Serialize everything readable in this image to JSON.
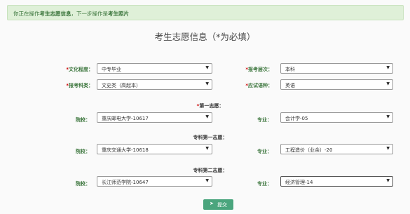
{
  "notice": {
    "prefix": "你正在操作",
    "current": "考生志愿信息",
    "middle": "，下一步操作是",
    "next": "考生照片"
  },
  "page_title": "考生志愿信息（*为必填）",
  "fields": {
    "education": {
      "label": "文化程度：",
      "value": "中专毕业"
    },
    "level": {
      "label": "报考层次：",
      "value": "本科"
    },
    "category": {
      "label": "报考科类：",
      "value": "文史类（高起本）"
    },
    "language": {
      "label": "应试语种：",
      "value": "英语"
    }
  },
  "sections": {
    "first": "第一志愿：",
    "college_first": "专科第一志愿：",
    "college_second": "专科第二志愿："
  },
  "choices": {
    "school_label": "院校：",
    "major_label": "专业：",
    "first": {
      "school": "重庆邮电大学-10617",
      "major": "会计学-05"
    },
    "college_first": {
      "school": "重庆交通大学-10618",
      "major": "工程造价（业余）-20"
    },
    "college_second": {
      "school": "长江师范学院-10647",
      "major": "经济管理-14"
    }
  },
  "submit_label": "提交",
  "icons": {
    "submit": "send-icon",
    "dropdown": "caret-down-icon"
  }
}
